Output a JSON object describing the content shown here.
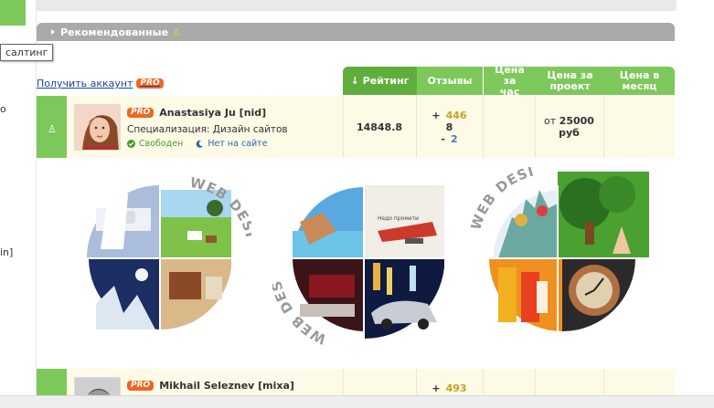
{
  "sidebar": {
    "tooltip": "салтинг",
    "fragment_o": "о",
    "fragment_in": "in]"
  },
  "section": {
    "title": "Рекомендованные"
  },
  "promo": {
    "get_account": "Получить аккаунт",
    "pro_label": "PRO"
  },
  "columns": {
    "rating": "↓ Рейтинг",
    "reviews": "Отзывы",
    "price_hour": "Цена за час",
    "price_project": "Цена за проект",
    "price_month": "Цена в месяц"
  },
  "freelancers": [
    {
      "name": "Anastasiya Ju [nid]",
      "pro": "PRO",
      "specialization": "Специализация: Дизайн сайтов",
      "status_free": "Свободен",
      "status_online": "Нет на сайте",
      "rating": "14848.8",
      "reviews_pos": "446",
      "reviews_neu": "8",
      "reviews_neg": "2",
      "sign_pos": "+",
      "sign_neg": "-",
      "price_project_prefix": "от",
      "price_project_value": "25000",
      "price_project_currency": "руб"
    },
    {
      "name": "Mikhail Seleznev [mixa]",
      "pro": "PRO",
      "reviews_pos": "493",
      "sign_pos": "+"
    }
  ],
  "portfolio": [
    {
      "caption": "WEB DESIGN"
    },
    {
      "caption": "WEB DESIGN",
      "inner_text": "Недо промети"
    },
    {
      "caption": "WEB DESIGN"
    }
  ],
  "colors": {
    "green": "#7dc85a",
    "green_dark": "#5fae3c",
    "row_bg": "#fdfae6",
    "pro": "#ee6622",
    "section_gray": "#aaaaaa"
  }
}
